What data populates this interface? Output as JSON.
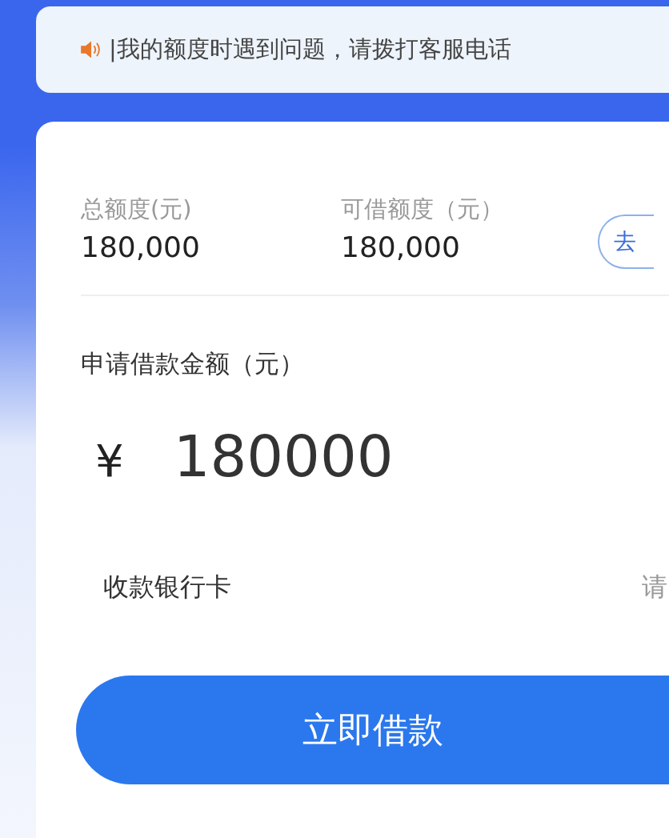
{
  "notice": {
    "text": "|我的额度时遇到问题，请拨打客服电话"
  },
  "quota": {
    "items": [
      {
        "label": "总额度(元)",
        "value": "180,000"
      },
      {
        "label": "可借额度（元）",
        "value": "180,000"
      }
    ],
    "action": "去"
  },
  "amount": {
    "label": "申请借款金额（元）",
    "currency": "¥",
    "value": "180000"
  },
  "bank_card": {
    "label": "收款银行卡",
    "value": "请"
  },
  "submit": "立即借款"
}
